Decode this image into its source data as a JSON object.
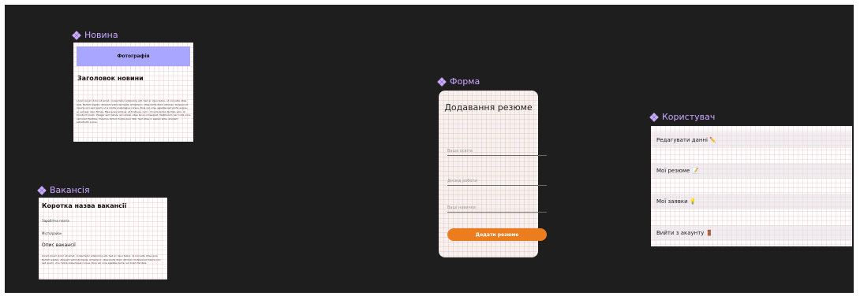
{
  "frames": {
    "news": {
      "label": "Новина"
    },
    "vacancy": {
      "label": "Вакансія"
    },
    "form": {
      "label": "Форма"
    },
    "user": {
      "label": "Користувач"
    }
  },
  "news_card": {
    "photo_label": "Фотографія",
    "headline": "Заголовок новини",
    "body": "Lorem ipsum dolor sit amet, consectetur adipiscing elit. Sed ac risus tellus, ut convallis vitae quis. Nullam sapien. Aliquam vehicula ligula, et tempor, vitae porta diam ultricies. Quisque et mauris orci sed quam, ut a mollis scelerisque cursus. Duis vel urna, egestas sed porta augue, ac semper risus fames. Maecenas tempus, et tristique, nunc, id nulla lectus facilisis sem, at tincidunt lorem. Integer sed metus, accumsan vitae lacus consequat. Vestibulum nec nulla urna, vel lorem facilisis. Vivamus dictum turpis quis nibh. Sed vitae in sapien ante, aliquam sollicitudin purus."
  },
  "vacancy_card": {
    "title": "Коротка назва вакансії",
    "salary": "Заробітна плата",
    "city": "Місто/район",
    "description_heading": "Опис вакансії",
    "body": "Lorem ipsum dolor sit amet, consectetur adipiscing elit. Sed ac risus tellus, ut convallis vitae quis. Nullam sapien. Aliquam vehicula ligula, et tempor, vitae porta diam ultricies. Quisque et mauris orci sed quam, ut a mollis scelerisque cursus. Duis vel urna egestas porta, vel lorem facilisis."
  },
  "form_card": {
    "title": "Додавання резюме",
    "fields": [
      {
        "placeholder": "Ваша освіта"
      },
      {
        "placeholder": "Досвід роботи"
      },
      {
        "placeholder": "Ваші навички"
      }
    ],
    "submit_label": "Додати резюме"
  },
  "user_card": {
    "items": [
      {
        "label": "Редагувати данні ✏️"
      },
      {
        "label": "Мої резюме 📝"
      },
      {
        "label": "Мої заявки 💡"
      },
      {
        "label": "Вийти з акаунту 🚪"
      }
    ]
  },
  "colors": {
    "canvas_bg": "#1e1e1e",
    "frame_label": "#c9a8ff",
    "photo_bg": "#a9a6ff",
    "accent_button": "#ec7d1e"
  }
}
